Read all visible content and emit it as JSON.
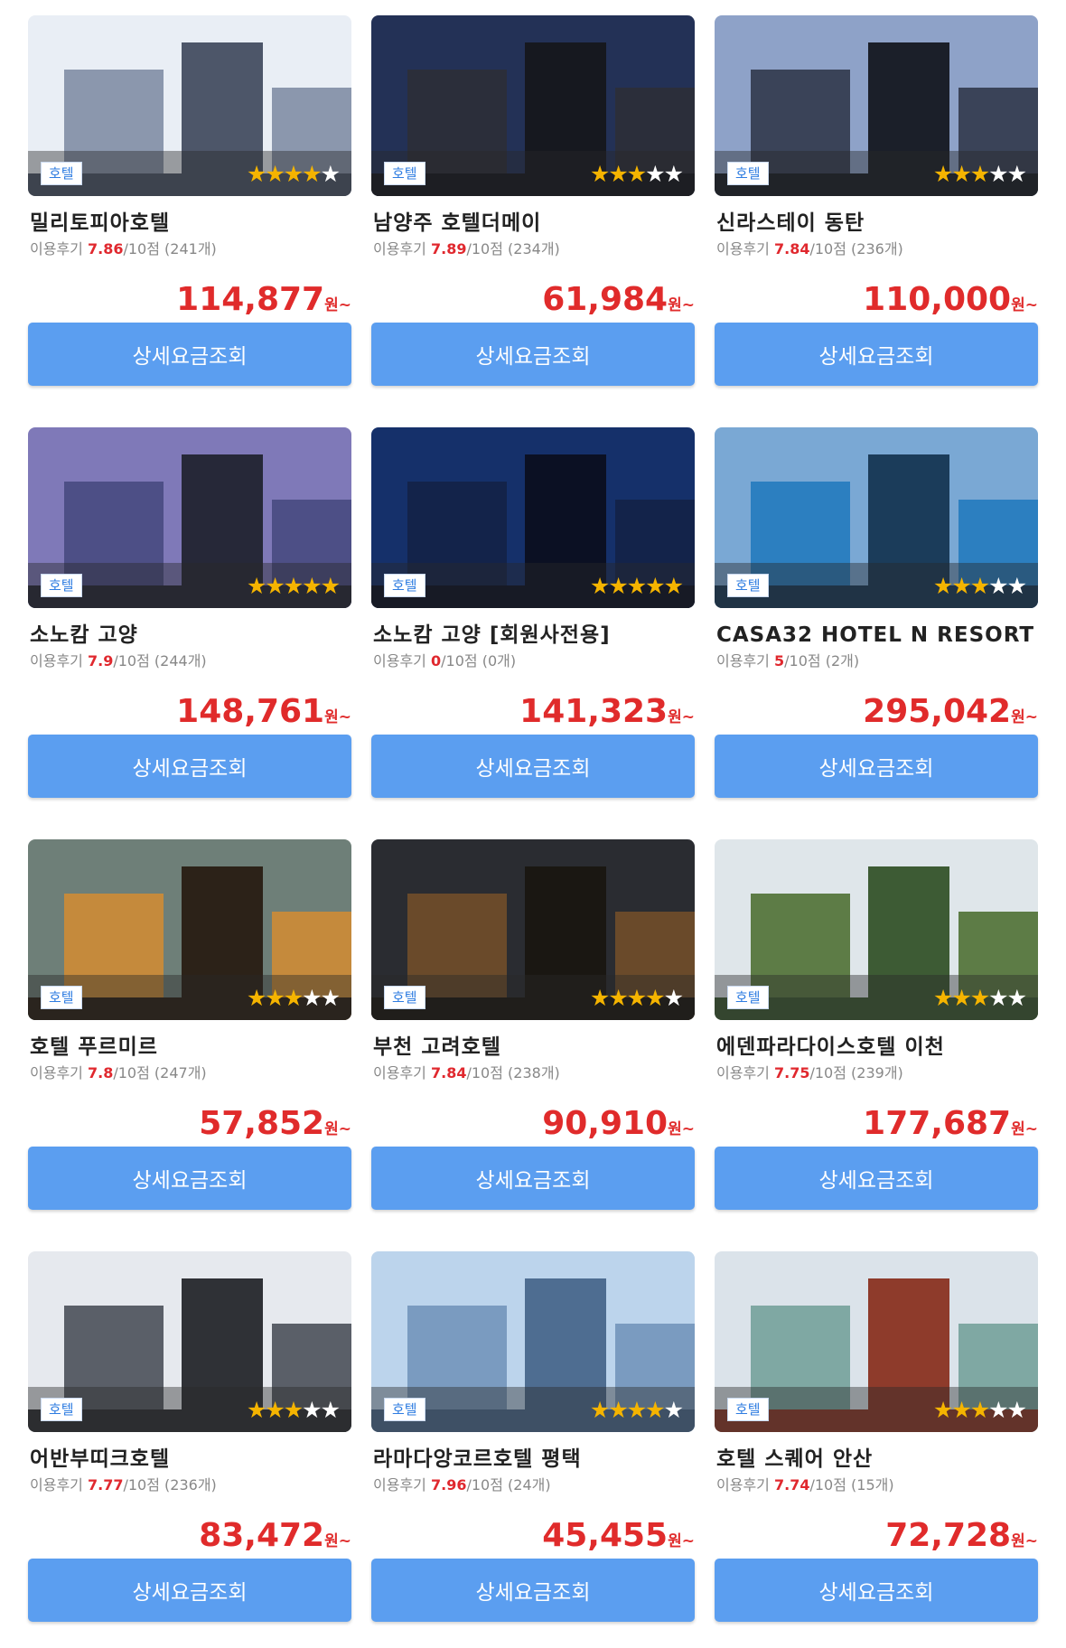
{
  "common": {
    "type_badge": "호텔",
    "review_prefix": "이용후기",
    "score_suffix": "/10점",
    "won_suffix": "원~",
    "detail_button_label": "상세요금조회"
  },
  "hotels": [
    {
      "name": "밀리토피아호텔",
      "score": "7.86",
      "count": "(241개)",
      "price": "114,877",
      "stars": 4,
      "colors": [
        "#e9eef5",
        "#8b97ad",
        "#4d5669"
      ]
    },
    {
      "name": "남양주 호텔더메이",
      "score": "7.89",
      "count": "(234개)",
      "price": "61,984",
      "stars": 3,
      "colors": [
        "#233156",
        "#2b2e3a",
        "#16181f"
      ]
    },
    {
      "name": "신라스테이 동탄",
      "score": "7.84",
      "count": "(236개)",
      "price": "110,000",
      "stars": 3,
      "colors": [
        "#8ea2c8",
        "#3a4358",
        "#1b1f29"
      ]
    },
    {
      "name": "소노캄 고양",
      "score": "7.9",
      "count": "(244개)",
      "price": "148,761",
      "stars": 5,
      "colors": [
        "#7f79b8",
        "#4d4f86",
        "#262838"
      ]
    },
    {
      "name": "소노캄 고양 [회원사전용]",
      "score": "0",
      "count": "(0개)",
      "price": "141,323",
      "stars": 5,
      "colors": [
        "#15306a",
        "#13234a",
        "#0b1023"
      ]
    },
    {
      "name": "CASA32 HOTEL N RESORT",
      "score": "5",
      "count": "(2개)",
      "price": "295,042",
      "stars": 3,
      "colors": [
        "#7aa8d4",
        "#2c7fc0",
        "#1b3c5a"
      ]
    },
    {
      "name": "호텔 푸르미르",
      "score": "7.8",
      "count": "(247개)",
      "price": "57,852",
      "stars": 3,
      "colors": [
        "#6e7f78",
        "#c58a3c",
        "#2c2218"
      ]
    },
    {
      "name": "부천 고려호텔",
      "score": "7.84",
      "count": "(238개)",
      "price": "90,910",
      "stars": 4,
      "colors": [
        "#2a2c31",
        "#6a4a2a",
        "#1a1712"
      ]
    },
    {
      "name": "에덴파라다이스호텔 이천",
      "score": "7.75",
      "count": "(239개)",
      "price": "177,687",
      "stars": 3,
      "colors": [
        "#dfe6ea",
        "#5d7c46",
        "#3d5b34"
      ]
    },
    {
      "name": "어반부띠크호텔",
      "score": "7.77",
      "count": "(236개)",
      "price": "83,472",
      "stars": 3,
      "colors": [
        "#e6e9ee",
        "#5a5f68",
        "#2f3136"
      ]
    },
    {
      "name": "라마다앙코르호텔 평택",
      "score": "7.96",
      "count": "(24개)",
      "price": "45,455",
      "stars": 4,
      "colors": [
        "#bcd4ec",
        "#7a9bc0",
        "#4e6d91"
      ]
    },
    {
      "name": "호텔 스퀘어 안산",
      "score": "7.74",
      "count": "(15개)",
      "price": "72,728",
      "stars": 3,
      "colors": [
        "#dbe3ea",
        "#7fa8a3",
        "#8e3b2b"
      ]
    }
  ]
}
